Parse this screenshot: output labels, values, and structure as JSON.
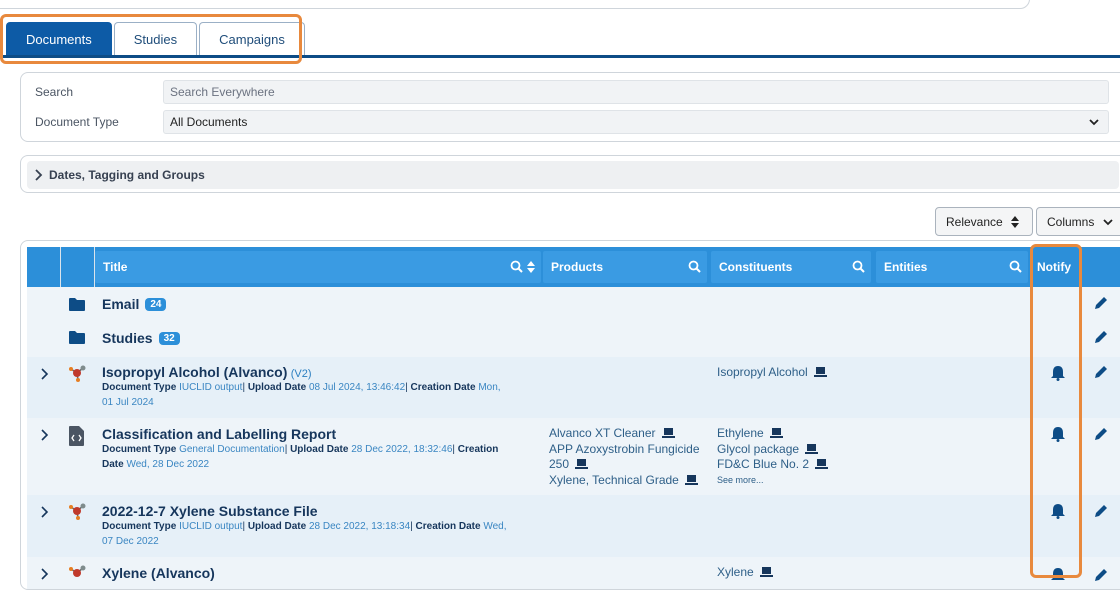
{
  "tabs": [
    {
      "label": "Documents",
      "active": true
    },
    {
      "label": "Studies",
      "active": false
    },
    {
      "label": "Campaigns",
      "active": false
    }
  ],
  "search": {
    "search_label": "Search",
    "search_placeholder": "Search Everywhere",
    "doctype_label": "Document Type",
    "doctype_value": "All Documents"
  },
  "filters": {
    "dates_label": "Dates, Tagging and Groups"
  },
  "sort": {
    "relevance_label": "Relevance",
    "columns_label": "Columns"
  },
  "table": {
    "headers": {
      "title": "Title",
      "products": "Products",
      "constituents": "Constituents",
      "entities": "Entities",
      "notify": "Notify"
    },
    "folders": [
      {
        "name": "Email",
        "count": "24"
      },
      {
        "name": "Studies",
        "count": "32"
      }
    ],
    "rows": [
      {
        "title": "Isopropyl Alcohol (Alvanco)",
        "version": "(V2)",
        "doc_type_label": "Document Type",
        "doc_type": "IUCLID output",
        "upload_label": "Upload Date",
        "upload_date": "08 Jul 2024, 13:46:42",
        "creation_label": "Creation Date",
        "creation_date_a": "Mon,",
        "creation_date_b": "01 Jul 2024",
        "constituents": [
          "Isopropyl Alcohol"
        ]
      },
      {
        "title": "Classification and Labelling Report",
        "doc_type_label": "Document Type",
        "doc_type": "General Documentation",
        "upload_label": "Upload Date",
        "upload_date": "28 Dec 2022, 18:32:46",
        "creation_label_a": "Creation",
        "creation_label_b": "Date",
        "creation_date": "Wed, 28 Dec 2022",
        "products": [
          "Alvanco XT Cleaner",
          "APP Azoxystrobin Fungicide",
          "250",
          "Xylene, Technical Grade"
        ],
        "constituents": [
          "Ethylene",
          "Glycol package",
          "FD&C Blue No. 2",
          "See more..."
        ]
      },
      {
        "title": "2022-12-7 Xylene Substance File",
        "doc_type_label": "Document Type",
        "doc_type": "IUCLID output",
        "upload_label": "Upload Date",
        "upload_date": "28 Dec 2022, 13:18:34",
        "creation_label": "Creation Date",
        "creation_date_a": "Wed,",
        "creation_date_b": "07 Dec 2022"
      },
      {
        "title": "Xylene (Alvanco)",
        "constituents": [
          "Xylene"
        ]
      }
    ]
  }
}
